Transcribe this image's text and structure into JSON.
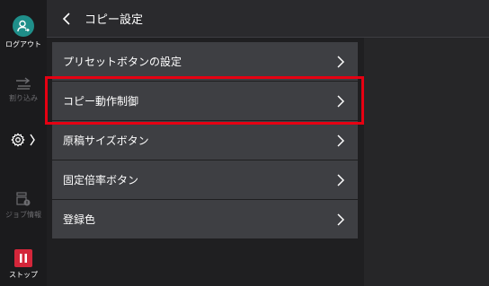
{
  "sidebar": {
    "logout_label": "ログアウト",
    "interrupt_label": "割り込み",
    "job_info_label": "ジョブ情報",
    "stop_label": "ストップ"
  },
  "header": {
    "title": "コピー設定"
  },
  "menu": {
    "items": [
      {
        "label": "プリセットボタンの設定"
      },
      {
        "label": "コピー動作制御"
      },
      {
        "label": "原稿サイズボタン"
      },
      {
        "label": "固定倍率ボタン"
      },
      {
        "label": "登録色"
      }
    ]
  },
  "colors": {
    "accent_logout": "#1f8f8a",
    "stop_red": "#d4263a",
    "highlight_red": "#e60012"
  },
  "icons": [
    "user-icon",
    "interrupt-icon",
    "gear-icon",
    "chevron-right-icon",
    "job-info-icon",
    "pause-icon",
    "back-chevron-icon"
  ]
}
